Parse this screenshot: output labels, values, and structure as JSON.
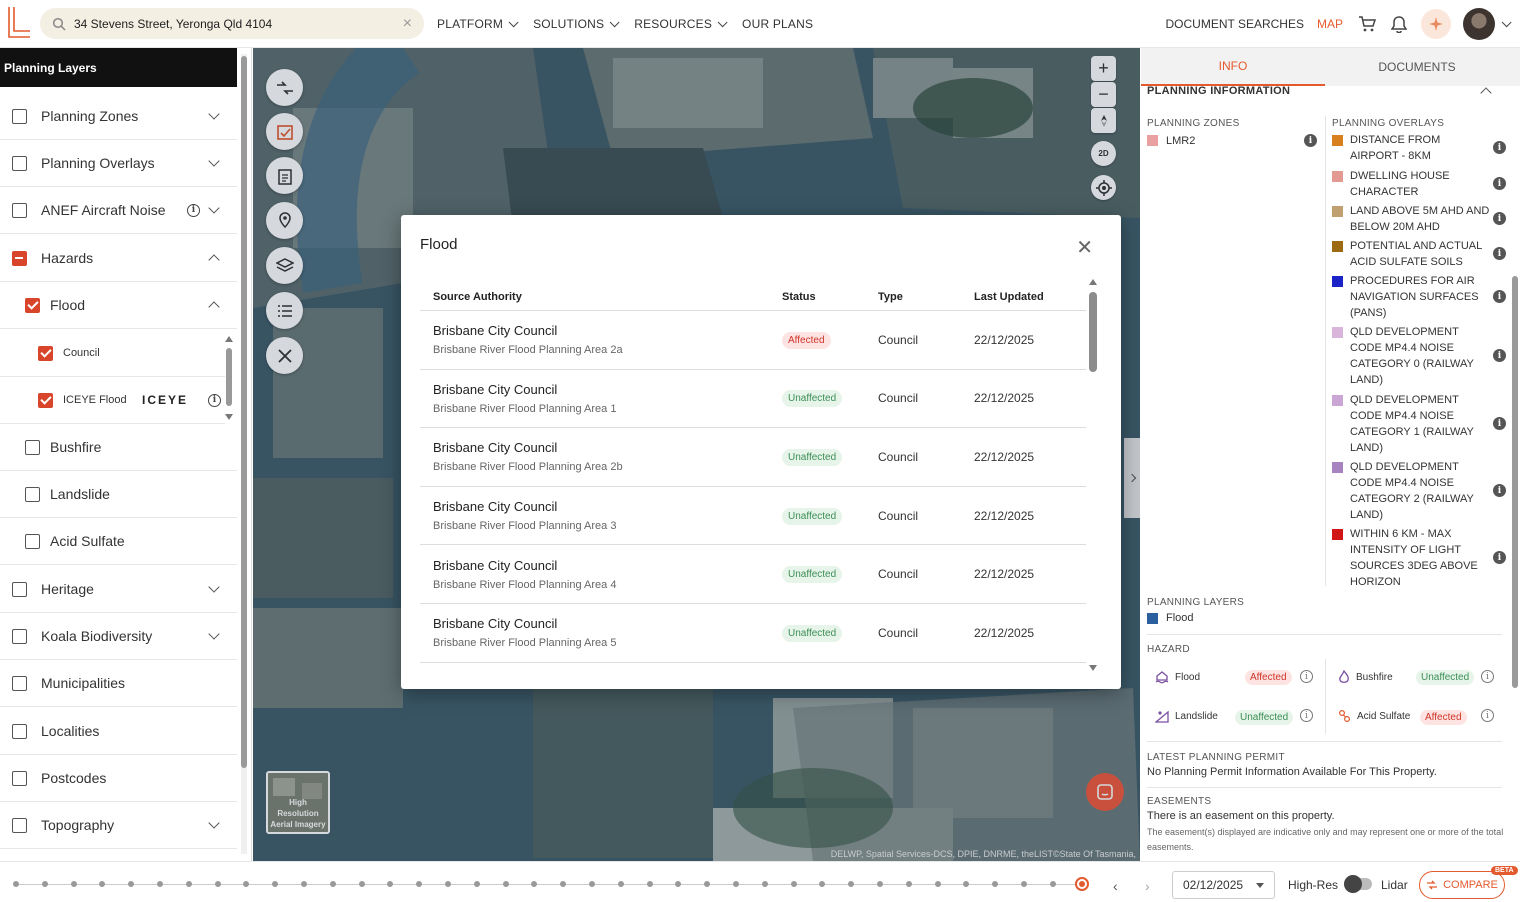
{
  "header": {
    "search_value": "34 Stevens Street, Yeronga Qld 4104",
    "nav": [
      "PLATFORM",
      "SOLUTIONS",
      "RESOURCES",
      "OUR PLANS"
    ],
    "document_searches": "DOCUMENT SEARCHES",
    "map": "MAP"
  },
  "left_panel": {
    "title": "Planning Layers",
    "layers": {
      "planning_zones": "Planning Zones",
      "planning_overlays": "Planning Overlays",
      "anef": "ANEF Aircraft Noise",
      "hazards": "Hazards",
      "flood": "Flood",
      "council": "Council",
      "iceye_flood": "ICEYE Flood",
      "iceye_logo": "ICEYE",
      "bushfire": "Bushfire",
      "landslide": "Landslide",
      "acid_sulfate": "Acid Sulfate",
      "heritage": "Heritage",
      "koala": "Koala Biodiversity",
      "municipalities": "Municipalities",
      "localities": "Localities",
      "postcodes": "Postcodes",
      "topography": "Topography"
    }
  },
  "map": {
    "zoom_in": "+",
    "zoom_out": "−",
    "mode_2d": "2D",
    "imagery_thumb": "High Resolution Aerial Imagery",
    "attribution": "DELWP, Spatial Services-DCS, DPIE, DNRME, theLIST©State Of Tasmania,"
  },
  "modal": {
    "title": "Flood",
    "columns": [
      "Source Authority",
      "Status",
      "Type",
      "Last Updated"
    ],
    "rows": [
      {
        "authority": "Brisbane City Council",
        "area": "Brisbane River Flood Planning Area 2a",
        "status": "Affected",
        "type": "Council",
        "updated": "22/12/2025"
      },
      {
        "authority": "Brisbane City Council",
        "area": "Brisbane River Flood Planning Area 1",
        "status": "Unaffected",
        "type": "Council",
        "updated": "22/12/2025"
      },
      {
        "authority": "Brisbane City Council",
        "area": "Brisbane River Flood Planning Area 2b",
        "status": "Unaffected",
        "type": "Council",
        "updated": "22/12/2025"
      },
      {
        "authority": "Brisbane City Council",
        "area": "Brisbane River Flood Planning Area 3",
        "status": "Unaffected",
        "type": "Council",
        "updated": "22/12/2025"
      },
      {
        "authority": "Brisbane City Council",
        "area": "Brisbane River Flood Planning Area 4",
        "status": "Unaffected",
        "type": "Council",
        "updated": "22/12/2025"
      },
      {
        "authority": "Brisbane City Council",
        "area": "Brisbane River Flood Planning Area 5",
        "status": "Unaffected",
        "type": "Council",
        "updated": "22/12/2025"
      }
    ]
  },
  "right_panel": {
    "tabs": [
      "INFO",
      "DOCUMENTS"
    ],
    "planning_information": "PLANNING INFORMATION",
    "planning_zones_heading": "PLANNING ZONES",
    "zone": {
      "name": "LMR2",
      "color": "#e8a0a0"
    },
    "planning_overlays_heading": "PLANNING OVERLAYS",
    "overlays": [
      {
        "text": "DISTANCE FROM AIRPORT - 8KM",
        "color": "#d9801e"
      },
      {
        "text": "DWELLING HOUSE CHARACTER",
        "color": "#e39a93"
      },
      {
        "text": "LAND ABOVE 5M AHD AND BELOW 20M AHD",
        "color": "#c0a070"
      },
      {
        "text": "POTENTIAL AND ACTUAL ACID SULFATE SOILS",
        "color": "#9b6a12"
      },
      {
        "text": "PROCEDURES FOR AIR NAVIGATION SURFACES (PANS)",
        "color": "#1a22c8"
      },
      {
        "text": "QLD DEVELOPMENT CODE MP4.4 NOISE CATEGORY 0 (RAILWAY LAND)",
        "color": "#d9b5dc"
      },
      {
        "text": "QLD DEVELOPMENT CODE MP4.4 NOISE CATEGORY 1 (RAILWAY LAND)",
        "color": "#c9a6d4"
      },
      {
        "text": "QLD DEVELOPMENT CODE MP4.4 NOISE CATEGORY 2 (RAILWAY LAND)",
        "color": "#a783c0"
      },
      {
        "text": "WITHIN 6 KM - MAX INTENSITY OF LIGHT SOURCES 3DEG ABOVE HORIZON",
        "color": "#d01616"
      }
    ],
    "planning_layers_heading": "PLANNING LAYERS",
    "planning_layer": {
      "name": "Flood",
      "color": "#2b5f9e"
    },
    "hazard_heading": "HAZARD",
    "hazards": {
      "flood": {
        "label": "Flood",
        "status": "Affected"
      },
      "bushfire": {
        "label": "Bushfire",
        "status": "Unaffected"
      },
      "landslide": {
        "label": "Landslide",
        "status": "Unaffected"
      },
      "acid_sulfate": {
        "label": "Acid Sulfate",
        "status": "Affected"
      }
    },
    "latest_permit_heading": "LATEST PLANNING PERMIT",
    "latest_permit_text": "No Planning Permit Information Available For This Property.",
    "easements_heading": "EASEMENTS",
    "easements_text": "There is an easement on this property.",
    "easements_note": "The easement(s) displayed are indicative only and may represent one or more of the total easements."
  },
  "timeline": {
    "date": "02/12/2025",
    "high_res": "High-Res",
    "lidar": "Lidar",
    "compare": "COMPARE",
    "beta": "BETA"
  }
}
